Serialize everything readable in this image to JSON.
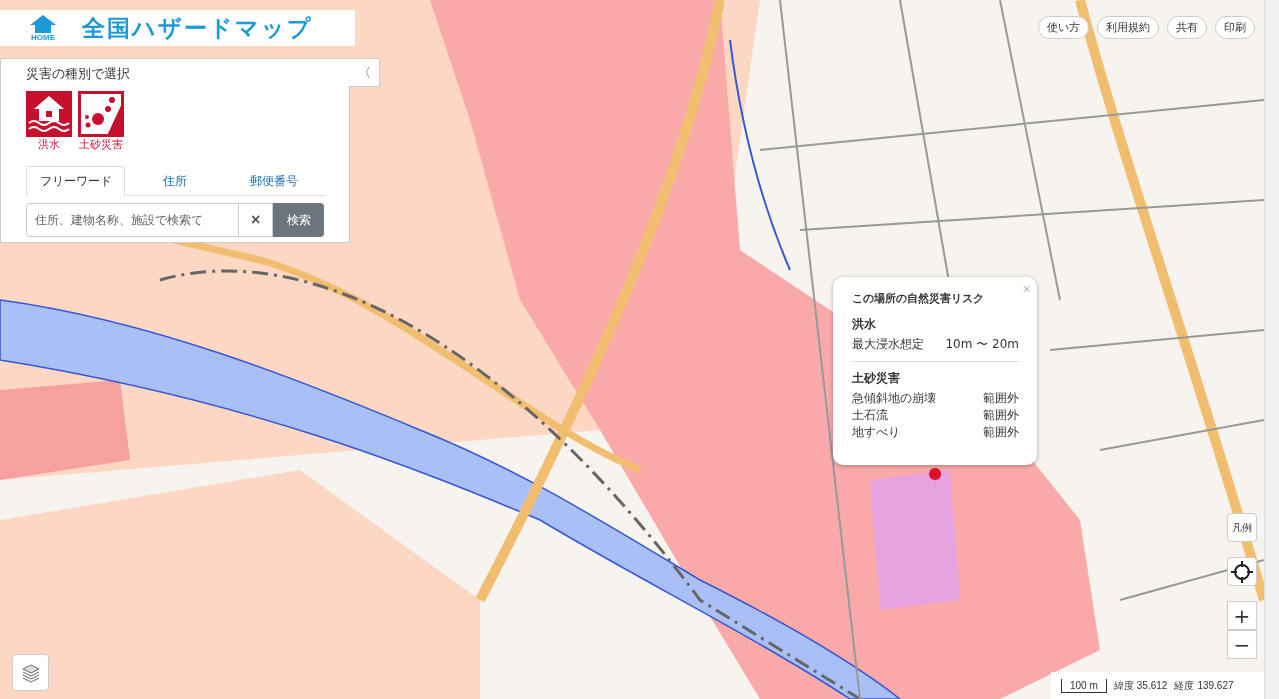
{
  "header": {
    "home_label": "HOME",
    "title": "全国ハザードマップ"
  },
  "top_buttons": [
    "使い方",
    "利用規約",
    "共有",
    "印刷"
  ],
  "panel": {
    "heading": "災害の種別で選択",
    "collapse": "〈",
    "hazards": [
      {
        "label": "洪水",
        "kind": "flood"
      },
      {
        "label": "土砂災害",
        "kind": "landslide"
      }
    ],
    "tabs": [
      {
        "label": "フリーワード",
        "selected": true
      },
      {
        "label": "住所",
        "selected": false
      },
      {
        "label": "郵便番号",
        "selected": false
      }
    ],
    "search": {
      "placeholder": "住所、建物名称、施設で検索て",
      "clear": "×",
      "button": "検索"
    }
  },
  "popup": {
    "title": "この場所の自然災害リスク",
    "close": "×",
    "sections": [
      {
        "heading": "洪水",
        "rows": [
          {
            "label": "最大浸水想定",
            "value": "10m 〜 20m"
          }
        ]
      },
      {
        "heading": "土砂災害",
        "rows": [
          {
            "label": "急傾斜地の崩壊",
            "value": "範囲外"
          },
          {
            "label": "土石流",
            "value": "範囲外"
          },
          {
            "label": "地すべり",
            "value": "範囲外"
          }
        ]
      }
    ]
  },
  "map_controls": {
    "legend": "凡例",
    "zoom_in": "+",
    "zoom_out": "−"
  },
  "status": {
    "scale": "100 m",
    "lat_label": "緯度",
    "lat": "35.612",
    "lon_label": "経度",
    "lon": "139.627"
  }
}
